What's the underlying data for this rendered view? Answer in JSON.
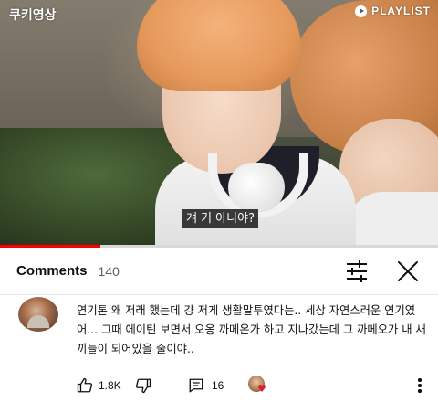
{
  "video": {
    "channel_logo": "쿠키영상",
    "brand_logo": "PLAYLIST",
    "subtitle": "걔 거 아니야?",
    "progress_fraction": 0.23
  },
  "comments_panel": {
    "title": "Comments",
    "count": "140",
    "filter_icon": "sliders-icon",
    "close_icon": "close-icon"
  },
  "comment": {
    "text": "연기톤 왜 저래 했는데 걍 저게 생활말투였다는.. 세상 자연스러운 연기였어... 그때 에이틴 보면서 오옹 까메온가 하고 지나갔는데 그 까메오가 내 새끼들이 되어있을 줄이야..",
    "likes": "1.8K",
    "replies": "16",
    "icons": {
      "like": "thumbs-up-icon",
      "dislike": "thumbs-down-icon",
      "reply": "reply-icon",
      "creator_heart": "creator-heart-icon",
      "more": "more-vertical-icon"
    }
  },
  "colors": {
    "progress": "#ff0000",
    "text": "#0f0f0f",
    "secondary_text": "#606060",
    "heart": "#e01f2b"
  }
}
